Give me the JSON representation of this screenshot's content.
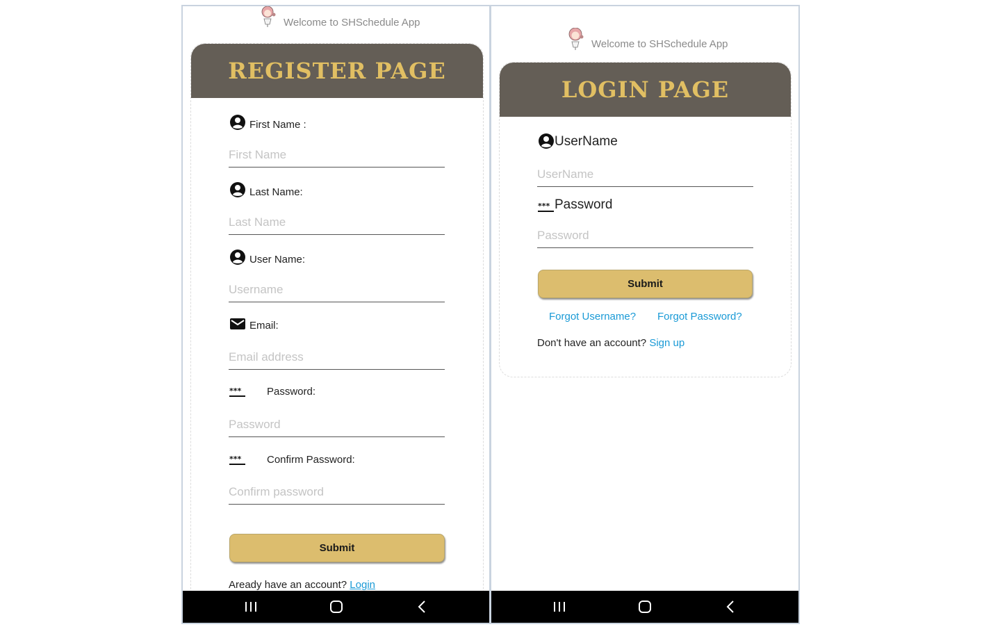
{
  "welcome_text": "Welcome to SHSchedule App",
  "register": {
    "title": "REGISTER PAGE",
    "fields": [
      {
        "label": "First Name :",
        "placeholder": "First Name",
        "icon": "user-circle-icon"
      },
      {
        "label": "Last Name:",
        "placeholder": "Last Name",
        "icon": "user-circle-icon"
      },
      {
        "label": "User Name:",
        "placeholder": "Username",
        "icon": "user-circle-icon"
      },
      {
        "label": "Email:",
        "placeholder": "Email address",
        "icon": "envelope-icon"
      },
      {
        "label": "Password:",
        "placeholder": "Password",
        "icon": "password-dots-icon"
      },
      {
        "label": "Confirm Password:",
        "placeholder": "Confirm password",
        "icon": "password-dots-icon"
      }
    ],
    "submit_label": "Submit",
    "footer_text": "Aready have an account?",
    "footer_link": "Login"
  },
  "login": {
    "title": "LOGIN PAGE",
    "username_label": "UserName",
    "username_placeholder": "UserName",
    "password_label": "Password",
    "password_placeholder": "Password",
    "submit_label": "Submit",
    "forgot_username": "Forgot Username?",
    "forgot_password": "Forgot Password?",
    "signup_prompt": "Don't have an account?",
    "signup_link": "Sign up"
  },
  "navbar": {
    "icons": [
      "recent-apps-icon",
      "home-icon",
      "back-icon"
    ]
  },
  "colors": {
    "header_bg": "#645e56",
    "header_text": "#e1bf63",
    "button_bg": "#dcbd6e",
    "link": "#1a9ad6",
    "navbar_bg": "#000000"
  }
}
